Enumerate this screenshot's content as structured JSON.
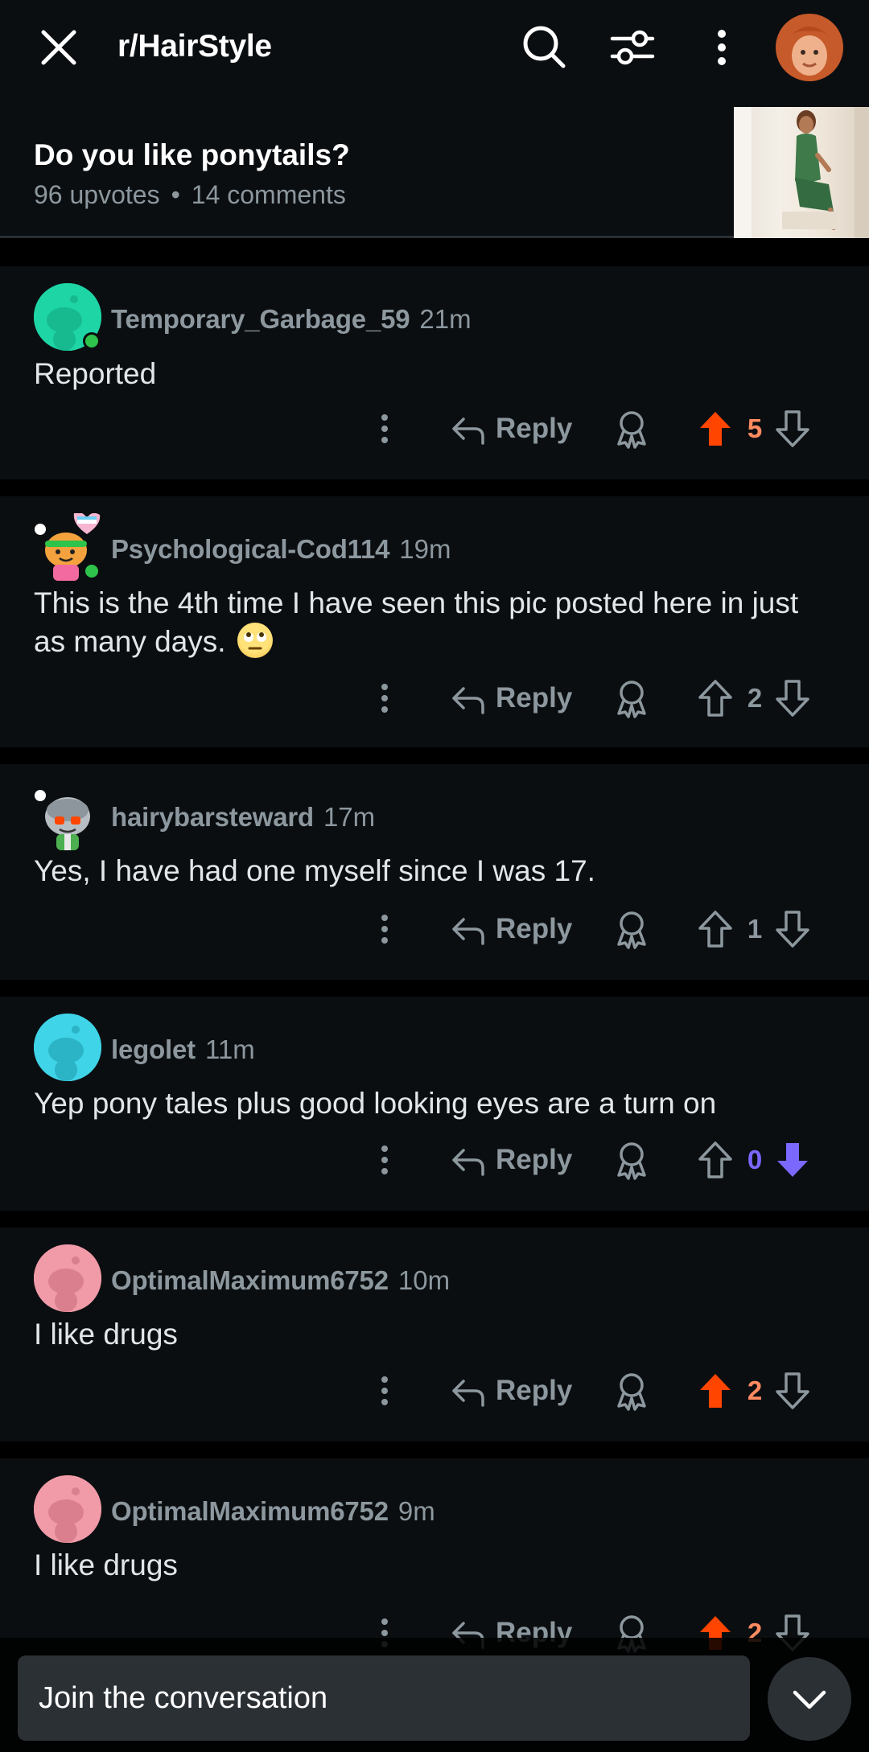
{
  "header": {
    "subreddit": "r/HairStyle",
    "icons": [
      "close-icon",
      "search-icon",
      "filter-icon",
      "more-vertical-icon",
      "user-avatar"
    ]
  },
  "post": {
    "title": "Do you like ponytails?",
    "upvotes": "96 upvotes",
    "separator": "•",
    "comments_count": "14 comments"
  },
  "comments": [
    {
      "author": "Temporary_Garbage_59",
      "time": "21m",
      "body": "Reported",
      "reply_label": "Reply",
      "score": "5",
      "vote": "up"
    },
    {
      "author": "Psychological-Cod114",
      "time": "19m",
      "body": "This is the 4th time I have seen this pic posted here in just as many days.",
      "emoji": "face-with-rolling-eyes",
      "reply_label": "Reply",
      "score": "2",
      "vote": "none"
    },
    {
      "author": "hairybarsteward",
      "time": "17m",
      "body": "Yes, I have had one myself since I was 17.",
      "reply_label": "Reply",
      "score": "1",
      "vote": "none"
    },
    {
      "author": "legolet",
      "time": "11m",
      "body": "Yep pony tales plus good looking eyes are a turn on",
      "reply_label": "Reply",
      "score": "0",
      "vote": "down"
    },
    {
      "author": "OptimalMaximum6752",
      "time": "10m",
      "body": "I like drugs",
      "reply_label": "Reply",
      "score": "2",
      "vote": "up"
    },
    {
      "author": "OptimalMaximum6752",
      "time": "9m",
      "body": "I like drugs",
      "reply_label": "Reply",
      "score": "2",
      "vote": "up"
    }
  ],
  "composer": {
    "placeholder": "Join the conversation"
  },
  "colors": {
    "background": "#000000",
    "card": "#0b0e11",
    "muted_text": "#8c979e",
    "upvote": "#ff4500",
    "upvote_score": "#ff8b60",
    "downvote": "#7a68ff"
  }
}
